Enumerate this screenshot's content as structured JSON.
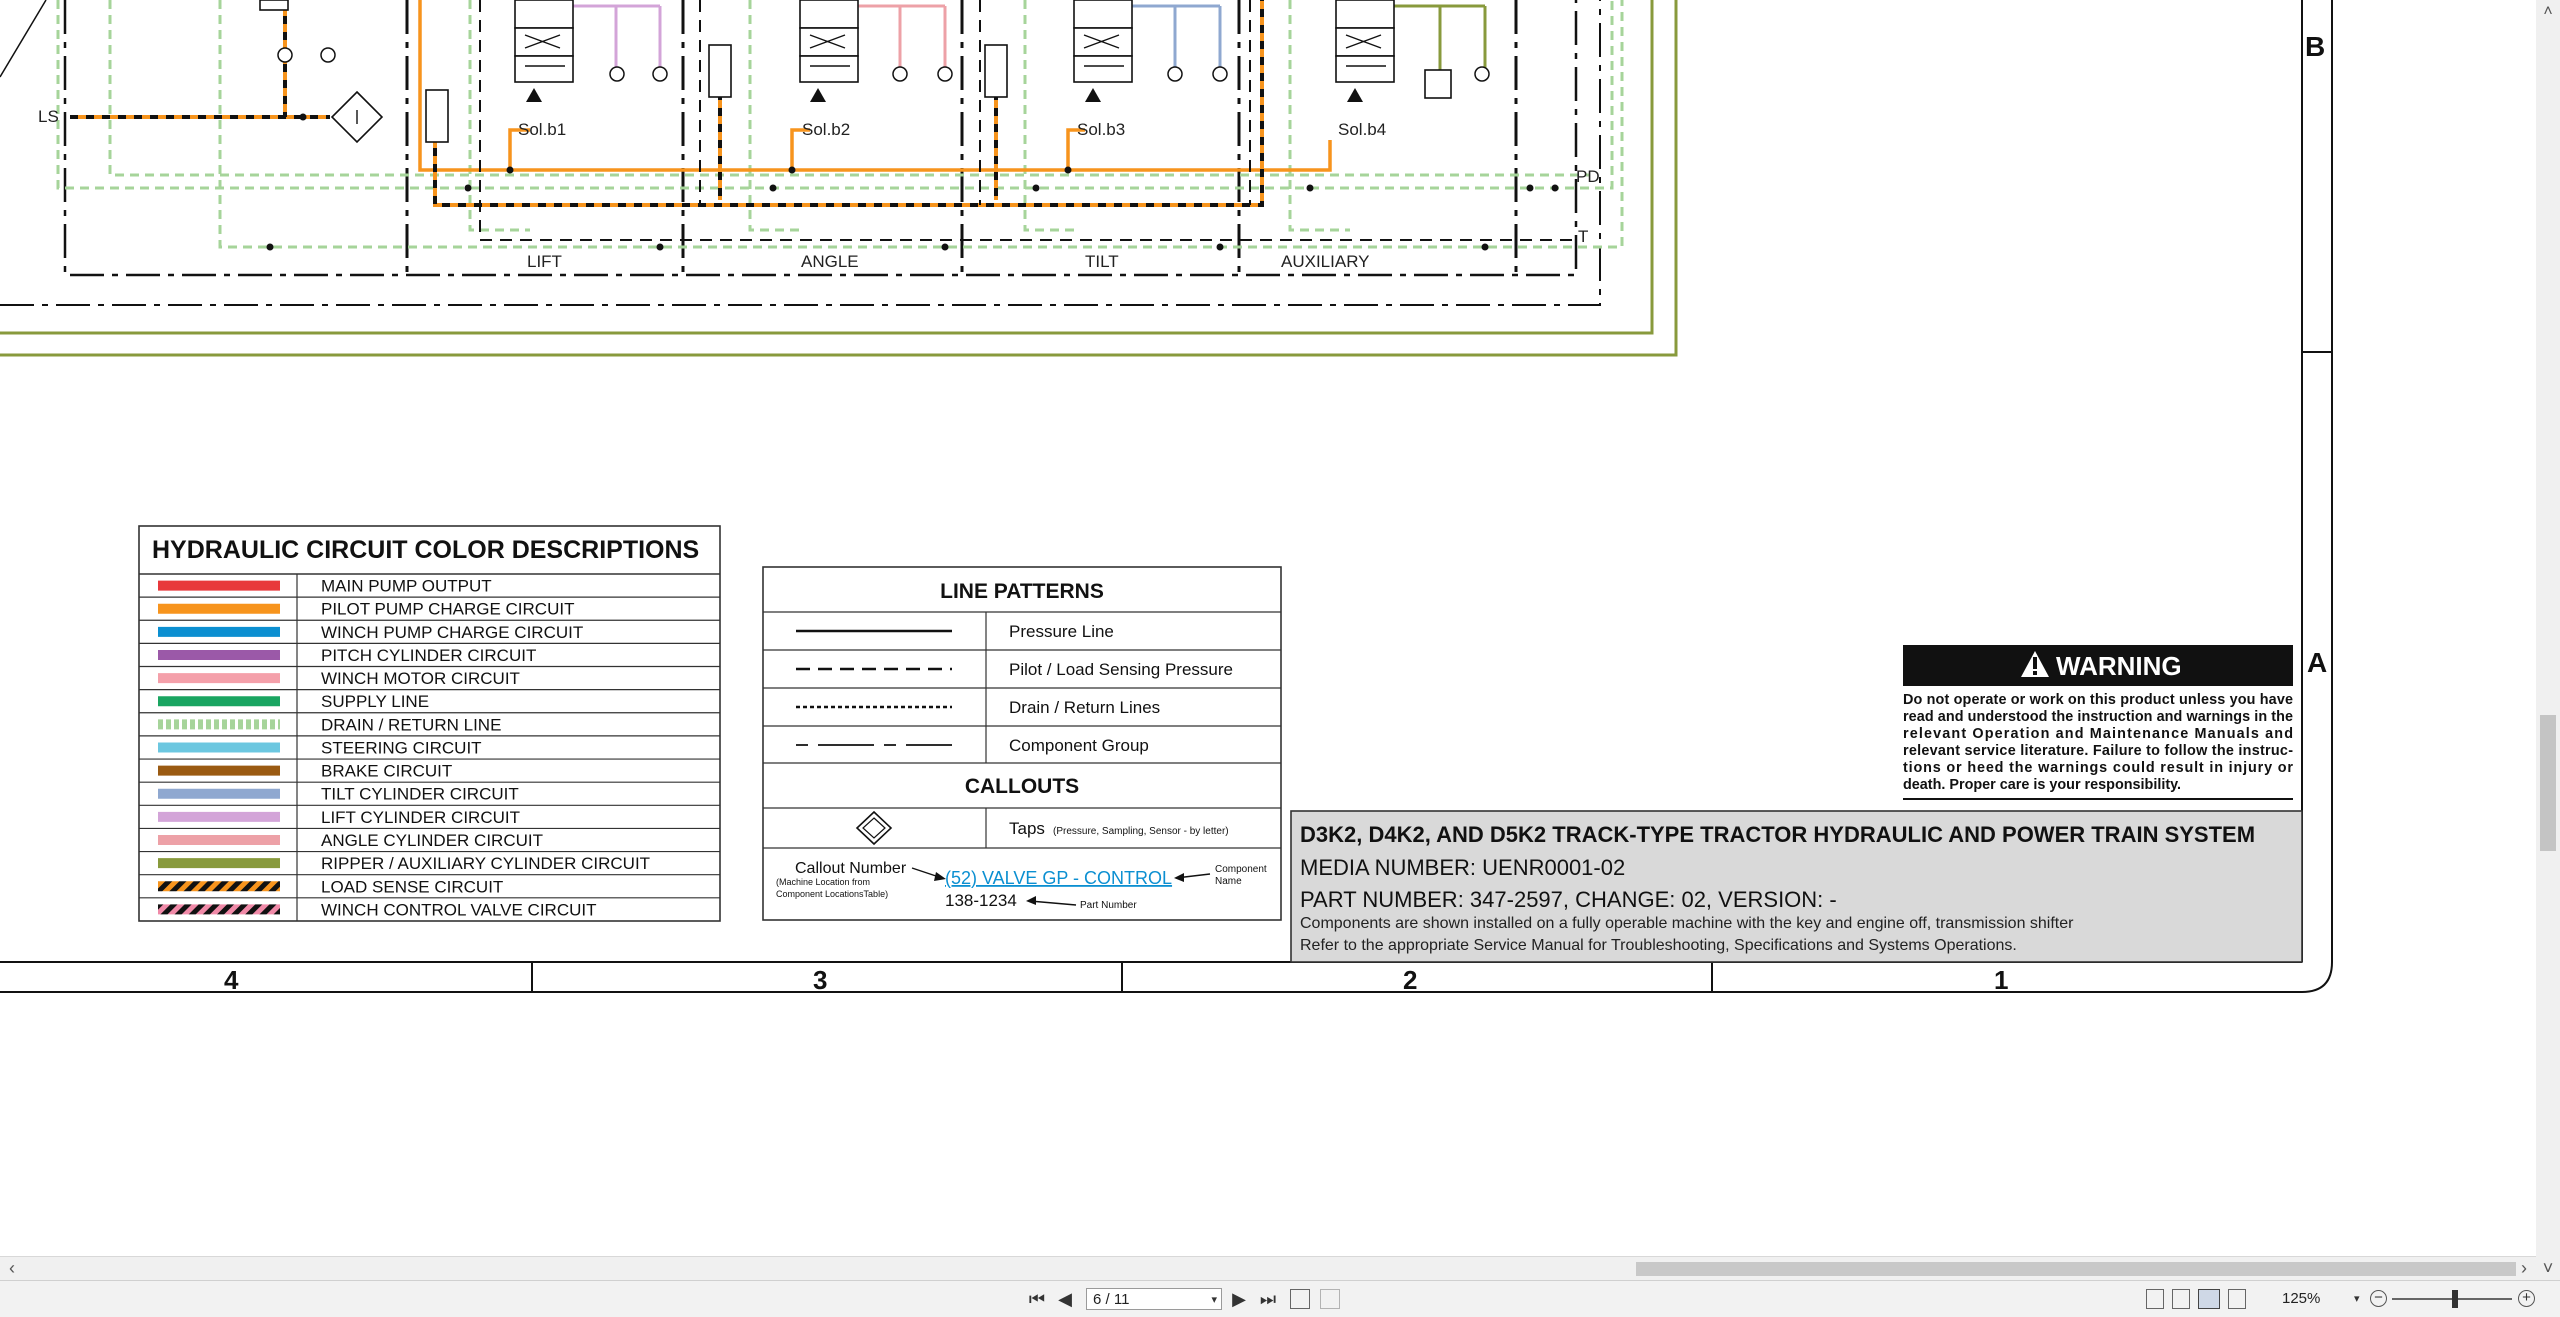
{
  "zones": {
    "row_b": "B",
    "row_a": "A",
    "columns": [
      "4",
      "3",
      "2",
      "1"
    ]
  },
  "schematic": {
    "ls_label": "LS",
    "pd_label": "PD",
    "t_label": "T",
    "solenoids": [
      "Sol.b1",
      "Sol.b2",
      "Sol.b3",
      "Sol.b4"
    ],
    "sections": [
      "LIFT",
      "ANGLE",
      "TILT",
      "AUXILIARY"
    ]
  },
  "legend": {
    "title": "HYDRAULIC CIRCUIT COLOR DESCRIPTIONS",
    "items": [
      {
        "label": "MAIN PUMP OUTPUT",
        "color": "#e8383b",
        "style": "solid"
      },
      {
        "label": "PILOT PUMP CHARGE CIRCUIT",
        "color": "#f7941d",
        "style": "solid"
      },
      {
        "label": "WINCH PUMP CHARGE CIRCUIT",
        "color": "#0b8fd1",
        "style": "solid"
      },
      {
        "label": "PITCH CYLINDER CIRCUIT",
        "color": "#9b59a8",
        "style": "solid"
      },
      {
        "label": "WINCH MOTOR CIRCUIT",
        "color": "#f4a0aa",
        "style": "solid"
      },
      {
        "label": "SUPPLY LINE",
        "color": "#1aa561",
        "style": "solid"
      },
      {
        "label": "DRAIN / RETURN LINE",
        "color": "#a6d49a",
        "style": "dash"
      },
      {
        "label": "STEERING CIRCUIT",
        "color": "#6cc7e0",
        "style": "solid"
      },
      {
        "label": "BRAKE CIRCUIT",
        "color": "#9a5a12",
        "style": "solid"
      },
      {
        "label": "TILT CYLINDER CIRCUIT",
        "color": "#8fa8d0",
        "style": "solid"
      },
      {
        "label": "LIFT CYLINDER CIRCUIT",
        "color": "#d3a4d8",
        "style": "solid"
      },
      {
        "label": "ANGLE CYLINDER CIRCUIT",
        "color": "#eda1a7",
        "style": "solid"
      },
      {
        "label": "RIPPER / AUXILIARY CYLINDER CIRCUIT",
        "color": "#889a3c",
        "style": "solid"
      },
      {
        "label": "LOAD SENSE CIRCUIT",
        "color": "#f7941d",
        "style": "stripe-black"
      },
      {
        "label": "WINCH CONTROL VALVE CIRCUIT",
        "color": "#f08aa8",
        "style": "stripe-black"
      }
    ]
  },
  "line_patterns": {
    "title": "LINE PATTERNS",
    "items": [
      {
        "label": "Pressure Line",
        "style": "solid"
      },
      {
        "label": "Pilot / Load Sensing Pressure",
        "style": "dashed"
      },
      {
        "label": "Drain / Return Lines",
        "style": "dotted"
      },
      {
        "label": "Component Group",
        "style": "dashdot"
      }
    ],
    "callouts_title": "CALLOUTS",
    "taps_label": "Taps",
    "taps_note": "(Pressure, Sampling, Sensor - by letter)",
    "callout_number": "Callout Number",
    "callout_note": "(Machine Location from Component LocationsTable)",
    "callout_link": "(52) VALVE GP - CONTROL",
    "component_name_1": "Component",
    "component_name_2": "Name",
    "part_number_value": "138-1234",
    "part_number_label": "Part Number"
  },
  "warning": {
    "title": "WARNING",
    "lines": [
      "Do not operate or work on this product unless you have",
      "read and understood the instruction and warnings in the",
      "relevant Operation and Maintenance Manuals and",
      "relevant service literature. Failure to follow the instruc-",
      "tions or heed the warnings could result in injury or",
      "death. Proper care is your responsibility."
    ]
  },
  "title_block": {
    "title": "D3K2, D4K2, AND D5K2 TRACK-TYPE TRACTOR HYDRAULIC AND POWER TRAIN SYSTEM",
    "media": "MEDIA NUMBER: UENR0001-02",
    "part": "PART NUMBER: 347-2597, CHANGE: 02, VERSION: -",
    "note1": "Components are shown installed on a fully operable machine with the key and engine off, transmission shifter",
    "note2": "Refer to the appropriate Service Manual for Troubleshooting, Specifications and Systems Operations."
  },
  "toolbar": {
    "page_value": "6 / 11",
    "zoom": "125%",
    "first_glyph": "⏮",
    "prev_glyph": "◀",
    "next_glyph": "▶",
    "last_glyph": "⏭",
    "minus_glyph": "−",
    "plus_glyph": "+",
    "dd_glyph": "▾"
  },
  "scroll": {
    "left": "‹",
    "right": "›",
    "up": "˄",
    "down": "˅"
  }
}
